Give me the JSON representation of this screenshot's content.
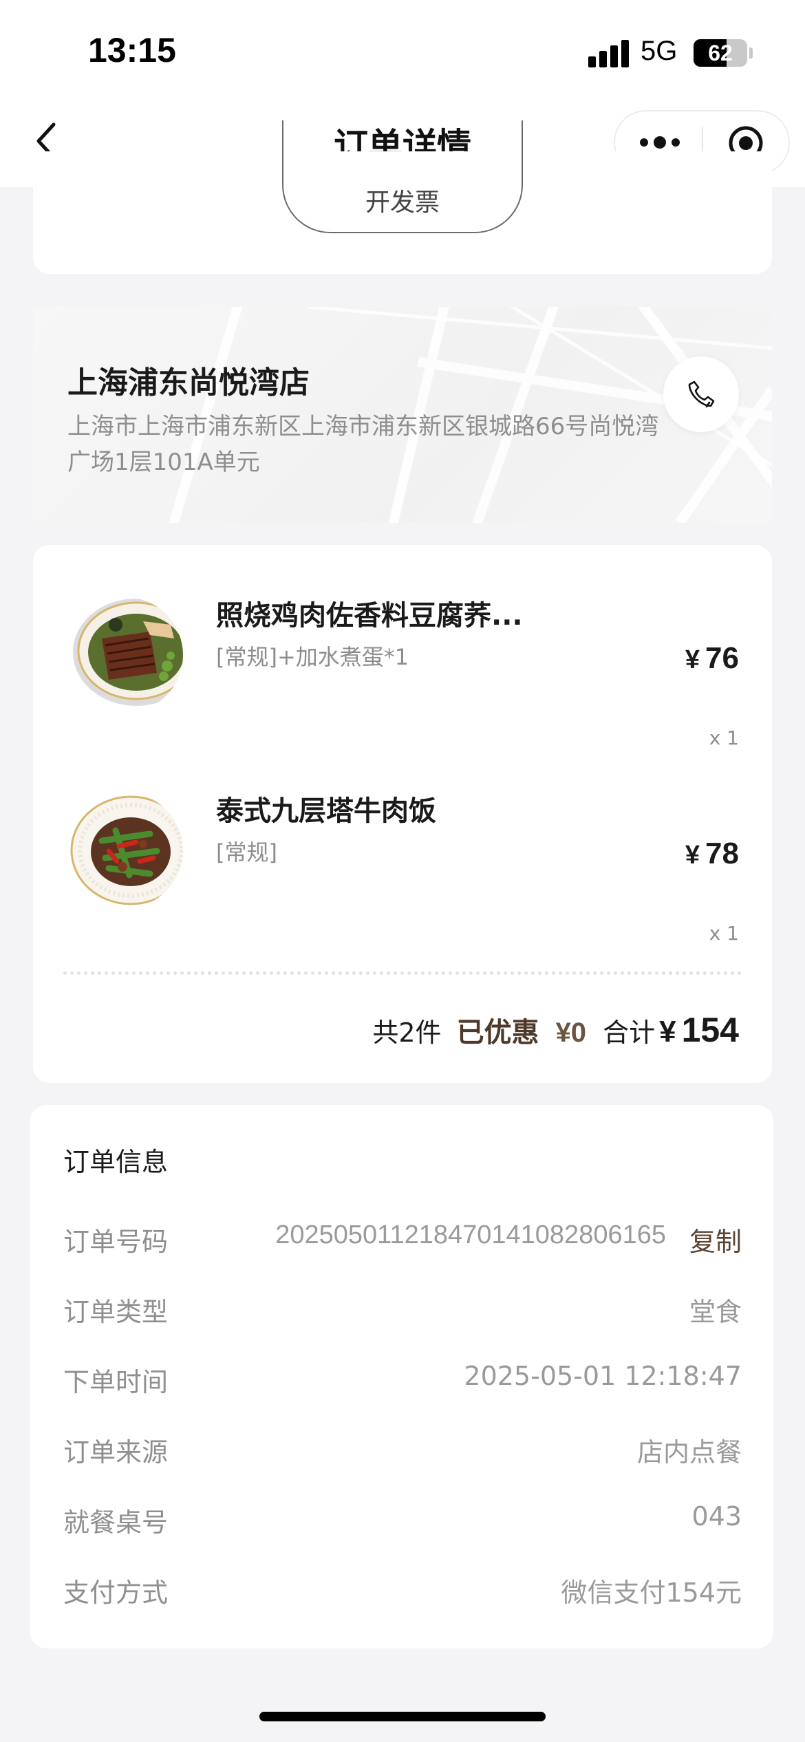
{
  "status_bar": {
    "time": "13:15",
    "network": "5G",
    "battery": "62",
    "battery_level": 0.62
  },
  "nav": {
    "title": "订单详情"
  },
  "top_card": {
    "invoice_button": "开发票"
  },
  "store": {
    "name": "上海浦东尚悦湾店",
    "address": "上海市上海市浦东新区上海市浦东新区银城路66号尚悦湾广场1层101A单元"
  },
  "items": [
    {
      "name": "照烧鸡肉佐香料豆腐荞...",
      "spec": "[常规]+加水煮蛋*1",
      "currency": "¥",
      "price": "76",
      "qty": "x 1"
    },
    {
      "name": "泰式九层塔牛肉饭",
      "spec": "[常规]",
      "currency": "¥",
      "price": "78",
      "qty": "x 1"
    }
  ],
  "summary": {
    "count": "共2件",
    "discount_label": "已优惠",
    "discount_value": "¥0",
    "total_label": "合计",
    "currency": "¥",
    "total": "154"
  },
  "order_info": {
    "title": "订单信息",
    "copy_label": "复制",
    "rows": [
      {
        "label": "订单号码",
        "value": "2025050112184701410828061​65"
      },
      {
        "label": "订单类型",
        "value": "堂食"
      },
      {
        "label": "下单时间",
        "value": "2025-05-01 12:18:47"
      },
      {
        "label": "订单来源",
        "value": "店内点餐"
      },
      {
        "label": "就餐桌号",
        "value": "043"
      },
      {
        "label": "支付方式",
        "value": "微信支付154元"
      }
    ]
  },
  "icons": {
    "back": "back-chevron-icon",
    "more": "more-dots-icon",
    "close_target": "target-icon",
    "phone": "phone-icon"
  }
}
